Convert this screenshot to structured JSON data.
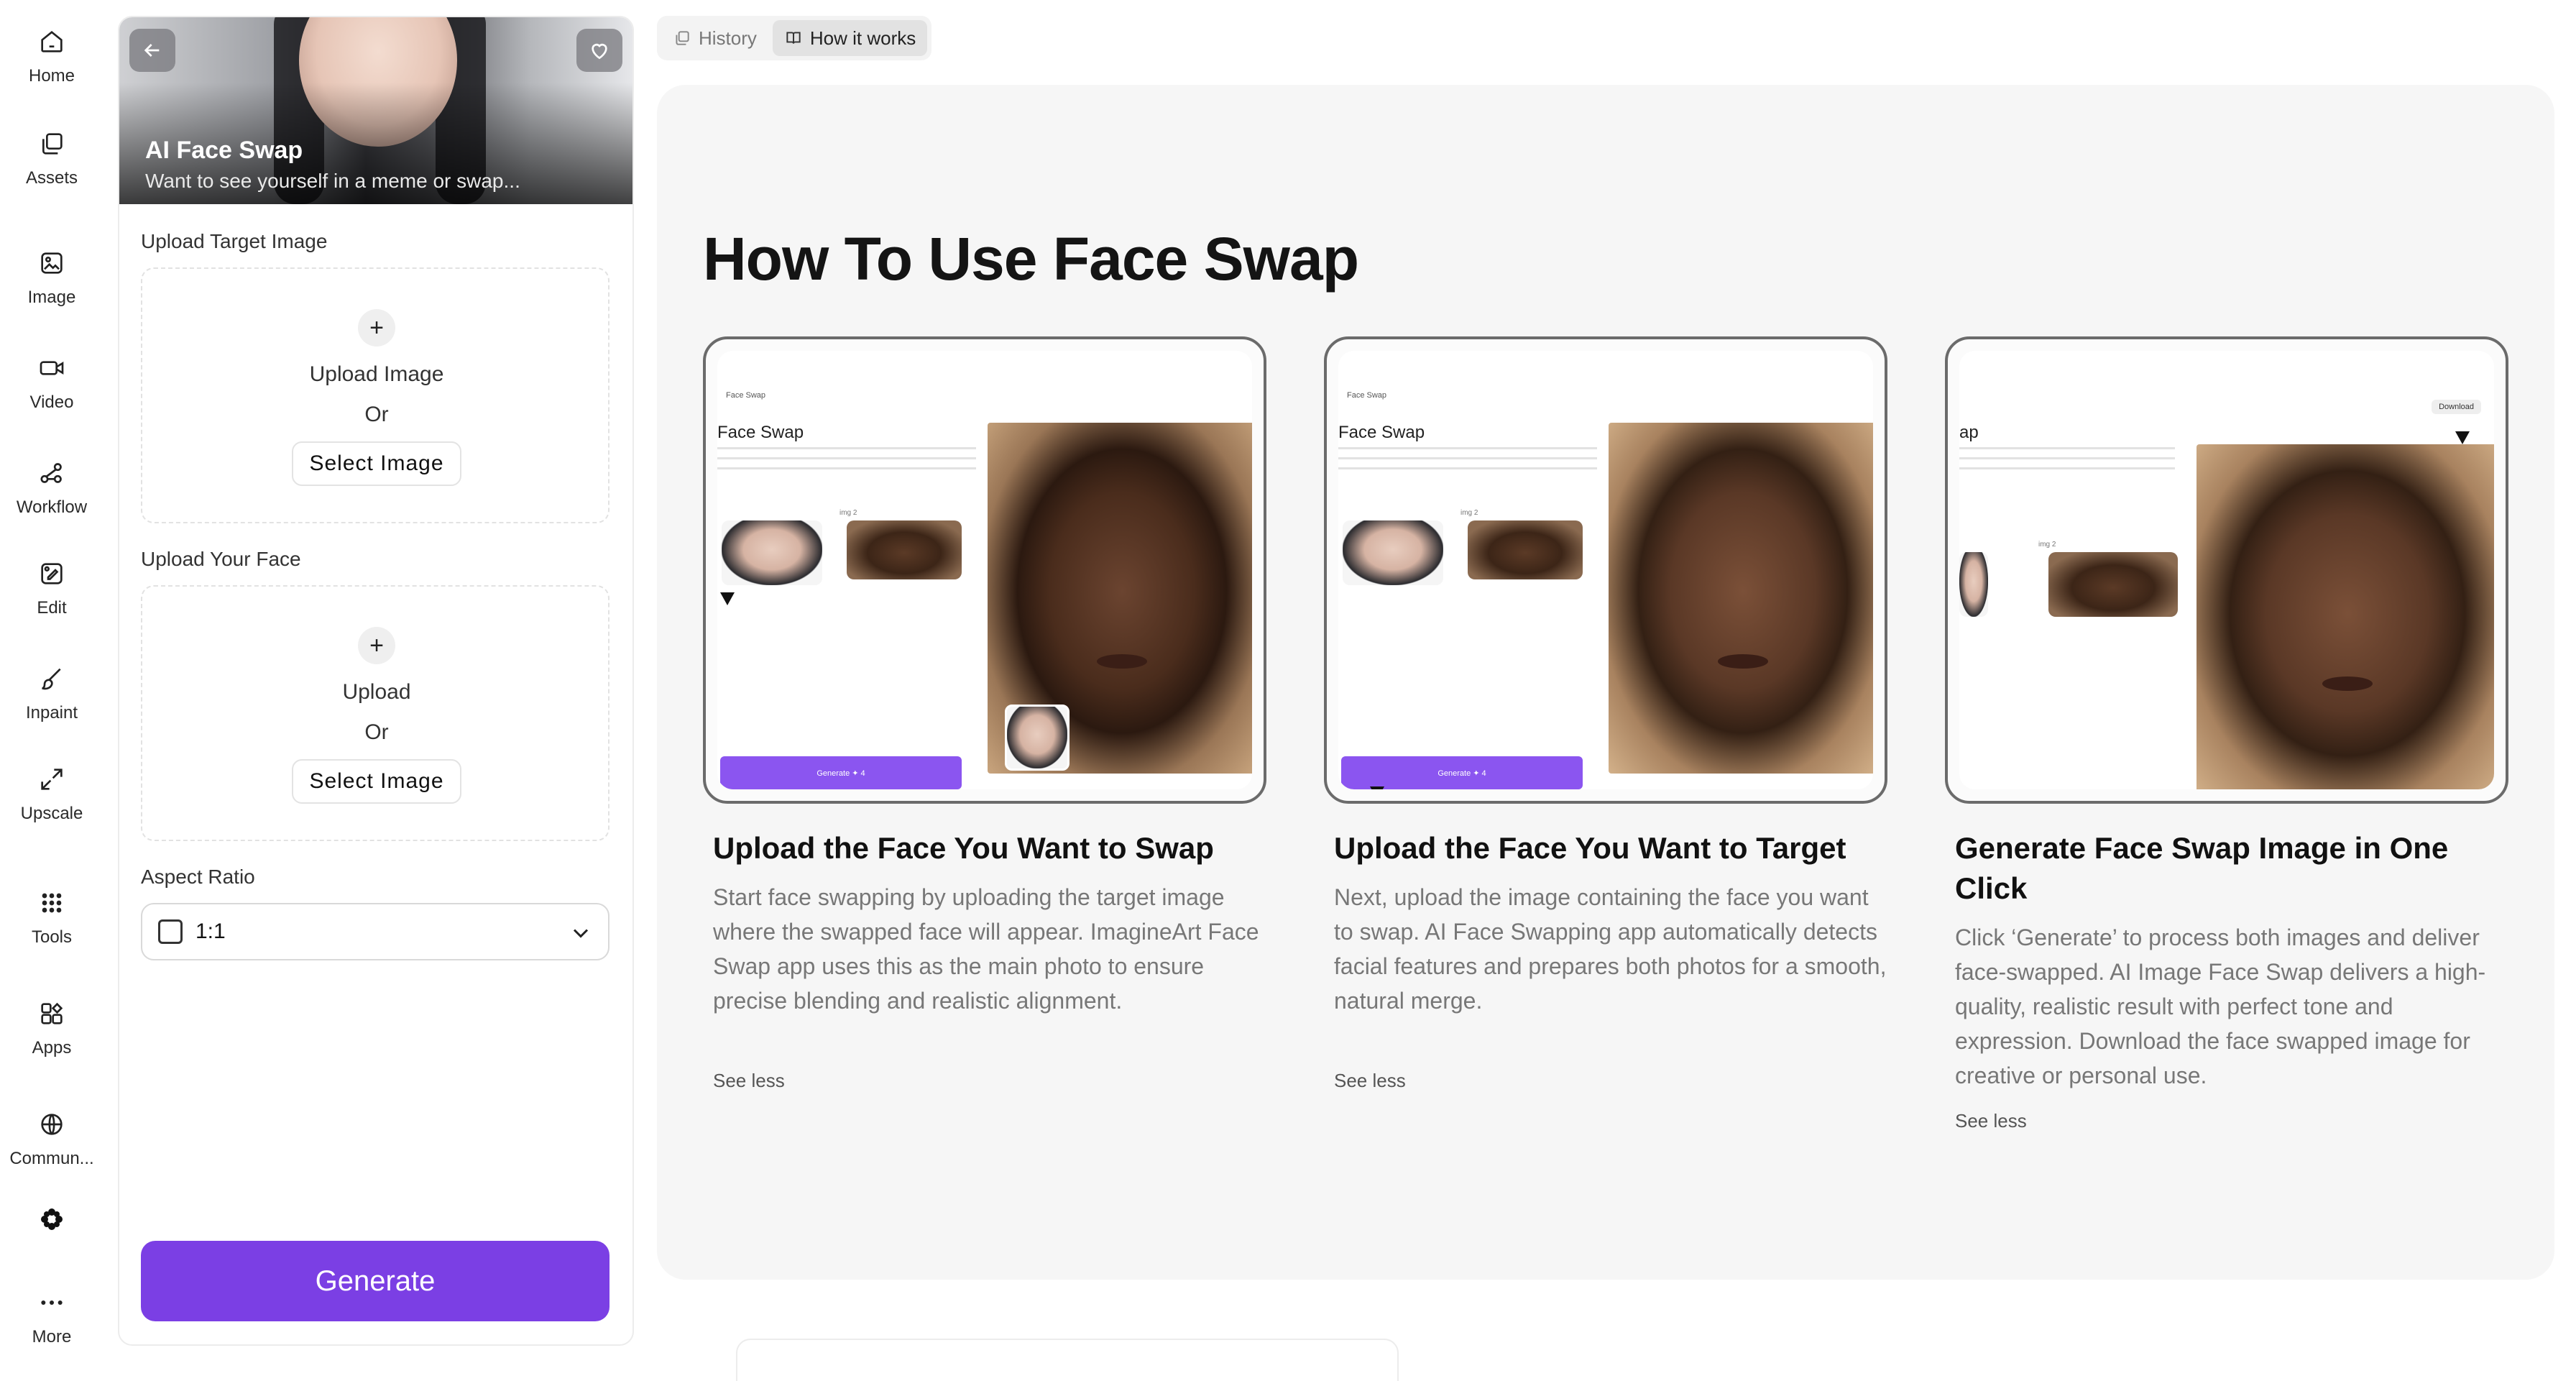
{
  "nav": {
    "items": [
      {
        "label": "Home",
        "icon": "home-icon"
      },
      {
        "label": "Assets",
        "icon": "assets-icon"
      },
      {
        "label": "Image",
        "icon": "image-icon"
      },
      {
        "label": "Video",
        "icon": "video-icon"
      },
      {
        "label": "Workflow",
        "icon": "workflow-icon"
      },
      {
        "label": "Edit",
        "icon": "edit-icon"
      },
      {
        "label": "Inpaint",
        "icon": "brush-icon"
      },
      {
        "label": "Upscale",
        "icon": "expand-icon"
      },
      {
        "label": "Tools",
        "icon": "grid-icon"
      },
      {
        "label": "Apps",
        "icon": "apps-icon"
      },
      {
        "label": "Commun...",
        "icon": "globe-icon"
      },
      {
        "label": "",
        "icon": "asterisk-logo-icon"
      },
      {
        "label": "More",
        "icon": "more-dots-icon"
      }
    ]
  },
  "panel": {
    "hero_title": "AI Face Swap",
    "hero_subtitle": "Want to see yourself in a meme or swap...",
    "target_label": "Upload Target Image",
    "target_upload_text": "Upload Image",
    "target_or": "Or",
    "target_select": "Select Image",
    "face_label": "Upload Your Face",
    "face_upload_text": "Upload",
    "face_or": "Or",
    "face_select": "Select Image",
    "aspect_label": "Aspect Ratio",
    "aspect_value": "1:1",
    "generate_label": "Generate"
  },
  "tabs": [
    {
      "label": "History",
      "icon": "history-icon",
      "active": false
    },
    {
      "label": "How it works",
      "icon": "book-icon",
      "active": true
    }
  ],
  "main": {
    "title": "How To Use Face Swap",
    "steps": [
      {
        "title": "Upload the Face You Want to Swap",
        "desc": "Start face swapping by uploading the target image where the swapped face will appear. ImagineArt Face Swap app uses this as the main photo to ensure precise blending and realistic alignment.",
        "toggle": "See less"
      },
      {
        "title": "Upload the Face You Want to Target",
        "desc": "Next, upload the image containing the face you want to swap. AI Face Swapping app automatically detects facial features and prepares both photos for a smooth, natural merge.",
        "toggle": "See less"
      },
      {
        "title": "Generate Face Swap Image in One Click",
        "desc": "Click ‘Generate’ to process both images and deliver face-swapped. AI Image Face Swap delivers a high-quality, realistic result with perfect tone and expression. Download the face swapped image for creative or personal use.",
        "toggle": "See less"
      }
    ],
    "mini": {
      "logo": "Face Swap",
      "title_a": "Face Swap",
      "title_b": "Face Swap",
      "title_c": "ap",
      "img2": "img 2",
      "gen": "Generate  ✦ 4",
      "download": "Download"
    }
  },
  "colors": {
    "accent": "#7b3fe4",
    "panel_bg": "#f6f6f6"
  }
}
